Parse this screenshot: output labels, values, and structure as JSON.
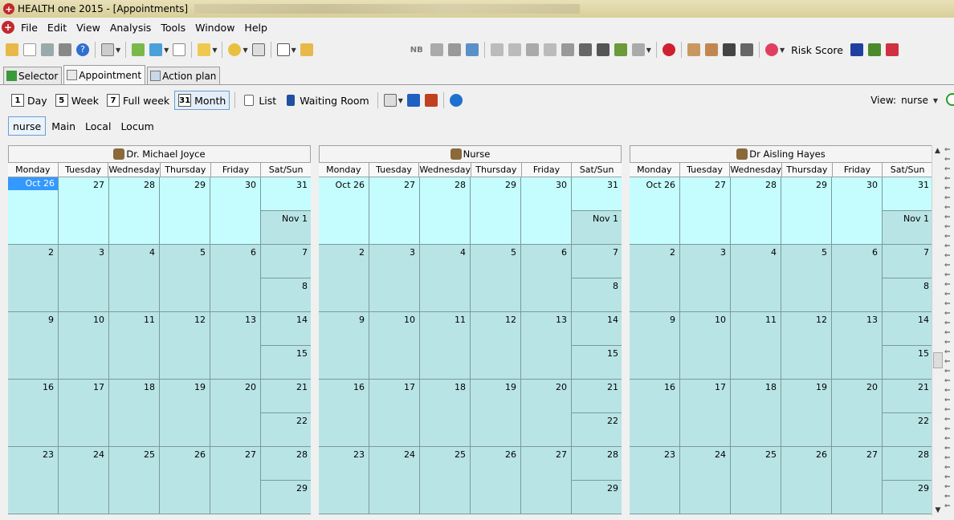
{
  "window": {
    "title": "HEALTH one 2015 - [Appointments]"
  },
  "menu": [
    "File",
    "Edit",
    "View",
    "Analysis",
    "Tools",
    "Window",
    "Help"
  ],
  "toolbar": {
    "nb": "NB",
    "risk_score": "Risk Score"
  },
  "tabs": [
    {
      "label": "Selector"
    },
    {
      "label": "Appointment"
    },
    {
      "label": "Action plan"
    }
  ],
  "viewbar": {
    "day": "Day",
    "day_num": "1",
    "week": "Week",
    "week_num": "5",
    "full_week": "Full week",
    "full_week_num": "7",
    "month": "Month",
    "month_num": "31",
    "list": "List",
    "waiting_room": "Waiting Room",
    "view_label": "View:",
    "view_value": "nurse"
  },
  "filters": [
    "nurse",
    "Main",
    "Local",
    "Locum"
  ],
  "calendar": {
    "day_headers": [
      "Monday",
      "Tuesday",
      "Wednesday",
      "Thursday",
      "Friday",
      "Sat/Sun"
    ],
    "panels": [
      {
        "name": "Dr. Michael Joyce"
      },
      {
        "name": "Nurse"
      },
      {
        "name": "Dr Aisling Hayes"
      }
    ],
    "weeks": [
      {
        "days": [
          "Oct 26",
          "27",
          "28",
          "29",
          "30"
        ],
        "sat": "31",
        "sun": "Nov 1"
      },
      {
        "days": [
          "2",
          "3",
          "4",
          "5",
          "6"
        ],
        "sat": "7",
        "sun": "8"
      },
      {
        "days": [
          "9",
          "10",
          "11",
          "12",
          "13"
        ],
        "sat": "14",
        "sun": "15"
      },
      {
        "days": [
          "16",
          "17",
          "18",
          "19",
          "20"
        ],
        "sat": "21",
        "sun": "22"
      },
      {
        "days": [
          "23",
          "24",
          "25",
          "26",
          "27"
        ],
        "sat": "28",
        "sun": "29"
      }
    ]
  }
}
